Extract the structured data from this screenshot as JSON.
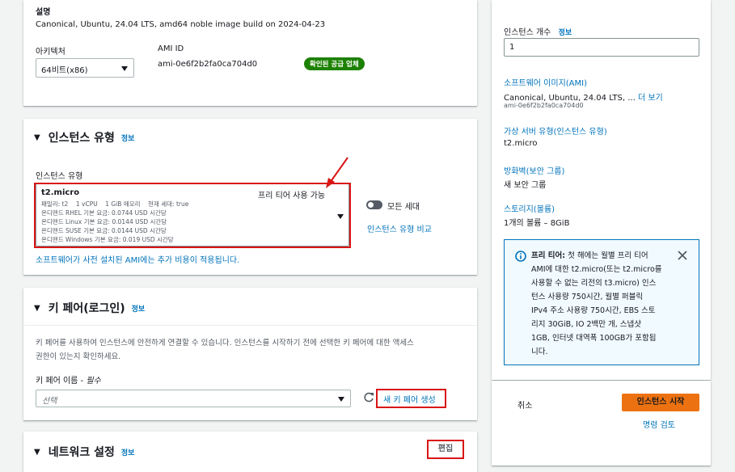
{
  "desc": {
    "label": "설명",
    "value": "Canonical, Ubuntu, 24.04 LTS, amd64 noble image build on 2024-04-23",
    "arch_label": "아키텍처",
    "arch_value": "64비트(x86)",
    "ami_id_label": "AMI ID",
    "ami_id_value": "ami-0e6f2b2fa0ca704d0",
    "verified_badge": "확인된 공급 업체"
  },
  "instance_type": {
    "title": "인스턴스 유형",
    "info": "정보",
    "field_label": "인스턴스 유형",
    "selected_name": "t2.micro",
    "free_tier": "프리 티어 사용 가능",
    "specs": "패밀리: t2    1 vCPU    1 GiB 메모리    현재 세대: true",
    "price_lines": [
      "온디맨드 RHEL 기본 요금: 0.0744 USD 시간당",
      "온디맨드 Linux 기본 요금: 0.0144 USD 시간당",
      "온디맨드 SUSE 기본 요금: 0.0144 USD 시간당",
      "온디맨드 Windows 기본 요금: 0.019 USD 시간당"
    ],
    "all_gen_label": "모든 세대",
    "compare_link": "인스턴스 유형 비교",
    "note": "소프트웨어가 사전 설치된 AMI에는 추가 비용이 적용됩니다."
  },
  "key_pair": {
    "title": "키 페어(로그인)",
    "info": "정보",
    "desc_line1": "키 페어를 사용하여 인스턴스에 안전하게 연결할 수 있습니다. 인스턴스를 시작하기 전에 선택한 키 페어에 대한 액세스",
    "desc_line2": "권한이 있는지 확인하세요.",
    "name_label": "키 페어 이름 -",
    "required": "필수",
    "placeholder": "선택",
    "create_link": "새 키 페어 생성"
  },
  "network": {
    "title": "네트워크 설정",
    "info": "정보",
    "edit": "편집"
  },
  "summary": {
    "count_label": "인스턴스 개수",
    "count_info": "정보",
    "count_value": "1",
    "ami_link": "소프트웨어 이미지(AMI)",
    "ami_value": "Canonical, Ubuntu, 24.04 LTS, ...",
    "ami_more": "더 보기",
    "ami_id": "ami-0e6f2b2fa0ca704d0",
    "type_link": "가상 서버 유형(인스턴스 유형)",
    "type_value": "t2.micro",
    "fw_link": "방화벽(보안 그룹)",
    "fw_value": "새 보안 그룹",
    "storage_link": "스토리지(볼륨)",
    "storage_value": "1개의 볼륨 – 8GiB",
    "free_tier_lines": [
      "첫 해에는 월별 프리 티어",
      "AMI에 대한 t2.micro(또는 t2.micro를",
      "사용할 수 없는 리전의 t3.micro) 인스",
      "턴스 사용량 750시간, 월별 퍼블릭",
      "IPv4 주소 사용량 750시간, EBS 스토",
      "리지 30GiB, IO 2백만 개, 스냅샷",
      "1GB, 인터넷 대역폭 100GB가 포함됩",
      "니다."
    ],
    "free_tier_title": "프리 티어:",
    "cancel": "취소",
    "launch": "인스턴스 시작",
    "review": "명령 검토"
  },
  "colors": {
    "accent": "#0073bb",
    "launch": "#ec7211",
    "badge": "#1d8102",
    "highlight": "#d91515"
  }
}
